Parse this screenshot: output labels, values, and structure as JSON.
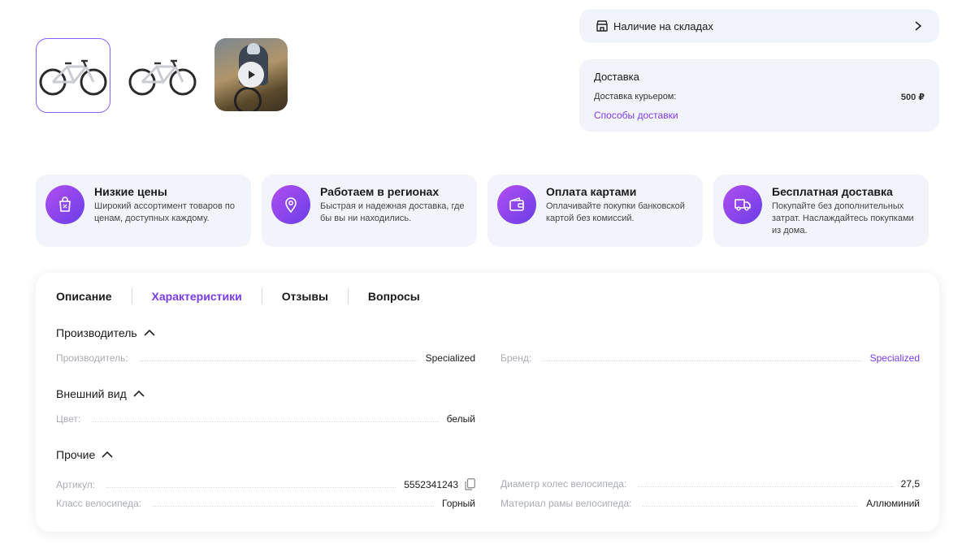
{
  "thumbnails": [
    {
      "name": "bike-photo-1"
    },
    {
      "name": "bike-photo-2"
    },
    {
      "name": "bike-video"
    }
  ],
  "stock": {
    "label": "Наличие на складах"
  },
  "delivery": {
    "title": "Доставка",
    "courier_label": "Доставка курьером:",
    "courier_price": "500 ₽",
    "methods_link": "Способы доставки"
  },
  "features": [
    {
      "title": "Низкие цены",
      "text": "Широкий ассортимент товаров по ценам, доступных каждому.",
      "icon": "shopping-bag-icon"
    },
    {
      "title": "Работаем в регионах",
      "text": "Быстрая и надежная доставка, где бы вы ни находились.",
      "icon": "location-pin-icon"
    },
    {
      "title": "Оплата картами",
      "text": "Оплачивайте покупки банковской картой без комиссий.",
      "icon": "wallet-icon"
    },
    {
      "title": "Бесплатная доставка",
      "text": "Покупайте без дополнительных затрат. Наслаждайтесь покупками из дома.",
      "icon": "truck-icon"
    }
  ],
  "tabs": [
    {
      "label": "Описание"
    },
    {
      "label": "Характеристики"
    },
    {
      "label": "Отзывы"
    },
    {
      "label": "Вопросы"
    }
  ],
  "sections": {
    "manufacturer": {
      "title": "Производитель",
      "rows": [
        {
          "key": "Производитель:",
          "value": "Specialized"
        },
        {
          "key": "Бренд:",
          "value": "Specialized"
        }
      ]
    },
    "appearance": {
      "title": "Внешний вид",
      "rows": [
        {
          "key": "Цвет:",
          "value": "белый"
        }
      ]
    },
    "other": {
      "title": "Прочие",
      "rows": [
        {
          "key": "Артикул:",
          "value": "5552341243"
        },
        {
          "key": "Диаметр колес велосипеда:",
          "value": "27,5"
        },
        {
          "key": "Класс велосипеда:",
          "value": "Горный"
        },
        {
          "key": "Материал рамы велосипеда:",
          "value": "Аллюминий"
        }
      ]
    }
  },
  "colors": {
    "accent": "#7c3aed",
    "panel": "#f2f4fb"
  }
}
